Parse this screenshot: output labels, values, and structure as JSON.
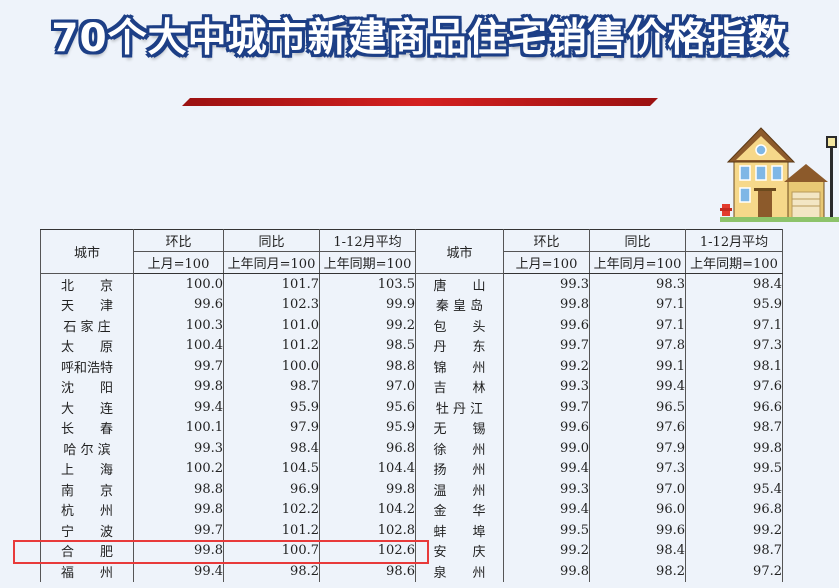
{
  "title": "70个大中城市新建商品住宅销售价格指数",
  "table": {
    "headers": {
      "city": "城市",
      "mom": "环比",
      "yoy": "同比",
      "avg": "1-12月平均",
      "mom_base": "上月=100",
      "yoy_base": "上年同月=100",
      "avg_base": "上年同期=100"
    },
    "rows": [
      {
        "c1": "北　　京",
        "m1": "100.0",
        "y1": "101.7",
        "a1": "103.5",
        "c2": "唐　　山",
        "m2": "99.3",
        "y2": "98.3",
        "a2": "98.4"
      },
      {
        "c1": "天　　津",
        "m1": "99.6",
        "y1": "102.3",
        "a1": "99.9",
        "c2": "秦 皇 岛",
        "m2": "99.8",
        "y2": "97.1",
        "a2": "95.9"
      },
      {
        "c1": "石 家 庄",
        "m1": "100.3",
        "y1": "101.0",
        "a1": "99.2",
        "c2": "包　　头",
        "m2": "99.6",
        "y2": "97.1",
        "a2": "97.1"
      },
      {
        "c1": "太　　原",
        "m1": "100.4",
        "y1": "101.2",
        "a1": "98.5",
        "c2": "丹　　东",
        "m2": "99.7",
        "y2": "97.8",
        "a2": "97.3"
      },
      {
        "c1": "呼和浩特",
        "m1": "99.7",
        "y1": "100.0",
        "a1": "98.8",
        "c2": "锦　　州",
        "m2": "99.2",
        "y2": "99.1",
        "a2": "98.1"
      },
      {
        "c1": "沈　　阳",
        "m1": "99.8",
        "y1": "98.7",
        "a1": "97.0",
        "c2": "吉　　林",
        "m2": "99.3",
        "y2": "99.4",
        "a2": "97.6"
      },
      {
        "c1": "大　　连",
        "m1": "99.4",
        "y1": "95.9",
        "a1": "95.6",
        "c2": "牡 丹 江",
        "m2": "99.7",
        "y2": "96.5",
        "a2": "96.6"
      },
      {
        "c1": "长　　春",
        "m1": "100.1",
        "y1": "97.9",
        "a1": "95.9",
        "c2": "无　　锡",
        "m2": "99.6",
        "y2": "97.6",
        "a2": "98.7"
      },
      {
        "c1": "哈 尔 滨",
        "m1": "99.3",
        "y1": "98.4",
        "a1": "96.8",
        "c2": "徐　　州",
        "m2": "99.0",
        "y2": "97.9",
        "a2": "99.8"
      },
      {
        "c1": "上　　海",
        "m1": "100.2",
        "y1": "104.5",
        "a1": "104.4",
        "c2": "扬　　州",
        "m2": "99.4",
        "y2": "97.3",
        "a2": "99.5"
      },
      {
        "c1": "南　　京",
        "m1": "98.8",
        "y1": "96.9",
        "a1": "99.8",
        "c2": "温　　州",
        "m2": "99.3",
        "y2": "97.0",
        "a2": "95.4"
      },
      {
        "c1": "杭　　州",
        "m1": "99.8",
        "y1": "102.2",
        "a1": "104.2",
        "c2": "金　　华",
        "m2": "99.4",
        "y2": "96.0",
        "a2": "96.8"
      },
      {
        "c1": "宁　　波",
        "m1": "99.7",
        "y1": "101.2",
        "a1": "102.8",
        "c2": "蚌　　埠",
        "m2": "99.5",
        "y2": "99.6",
        "a2": "99.2"
      },
      {
        "c1": "合　　肥",
        "m1": "99.8",
        "y1": "100.7",
        "a1": "102.6",
        "c2": "安　　庆",
        "m2": "99.2",
        "y2": "98.4",
        "a2": "98.7"
      },
      {
        "c1": "福　　州",
        "m1": "99.4",
        "y1": "98.2",
        "a1": "98.6",
        "c2": "泉　　州",
        "m2": "99.8",
        "y2": "98.2",
        "a2": "97.2"
      }
    ]
  },
  "colors": {
    "title_outline": "#1d3f86",
    "accent_bar": "#c81e1e",
    "highlight_box": "#e83a3a",
    "background": "#eef3fa"
  },
  "icons": {
    "house": "house-illustration-icon"
  },
  "highlighted_city": "合肥"
}
